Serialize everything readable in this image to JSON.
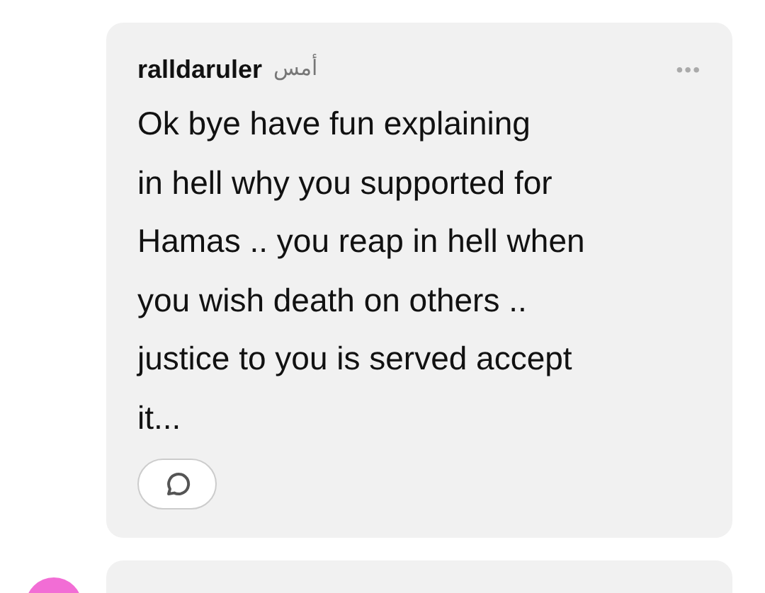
{
  "comments": [
    {
      "username": "ralldaruler",
      "time": "أمس",
      "menu": "•••",
      "text_lines": [
        "Ok bye have fun explaining",
        "in hell why you supported for",
        "Hamas .. you reap in hell when",
        "you wish death on others ..",
        "justice to you is served accept",
        "it..."
      ],
      "has_reply_button": true
    },
    {
      "color": "#f26dd5"
    }
  ]
}
